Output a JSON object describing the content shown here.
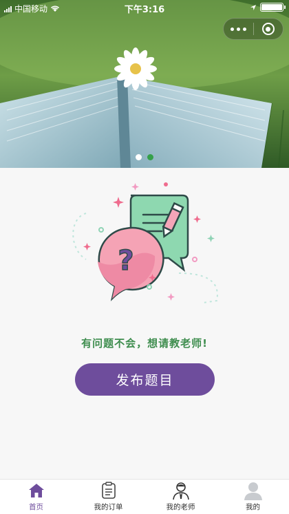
{
  "status_bar": {
    "carrier": "中国移动",
    "time": "下午3:16"
  },
  "banner": {
    "slide_count": 2,
    "active_index": 0
  },
  "main": {
    "question_text": "有问题不会，想请教老师!",
    "publish_label": "发布题目"
  },
  "tabs": [
    {
      "label": "首页",
      "icon": "home-icon",
      "active": true
    },
    {
      "label": "我的订单",
      "icon": "order-list-icon",
      "active": false
    },
    {
      "label": "我的老师",
      "icon": "teacher-icon",
      "active": false
    },
    {
      "label": "我的",
      "icon": "user-icon",
      "active": false
    }
  ],
  "colors": {
    "accent": "#6e4d9c",
    "question_text": "#3e8d4e",
    "tab_active": "#6e4d9c"
  }
}
